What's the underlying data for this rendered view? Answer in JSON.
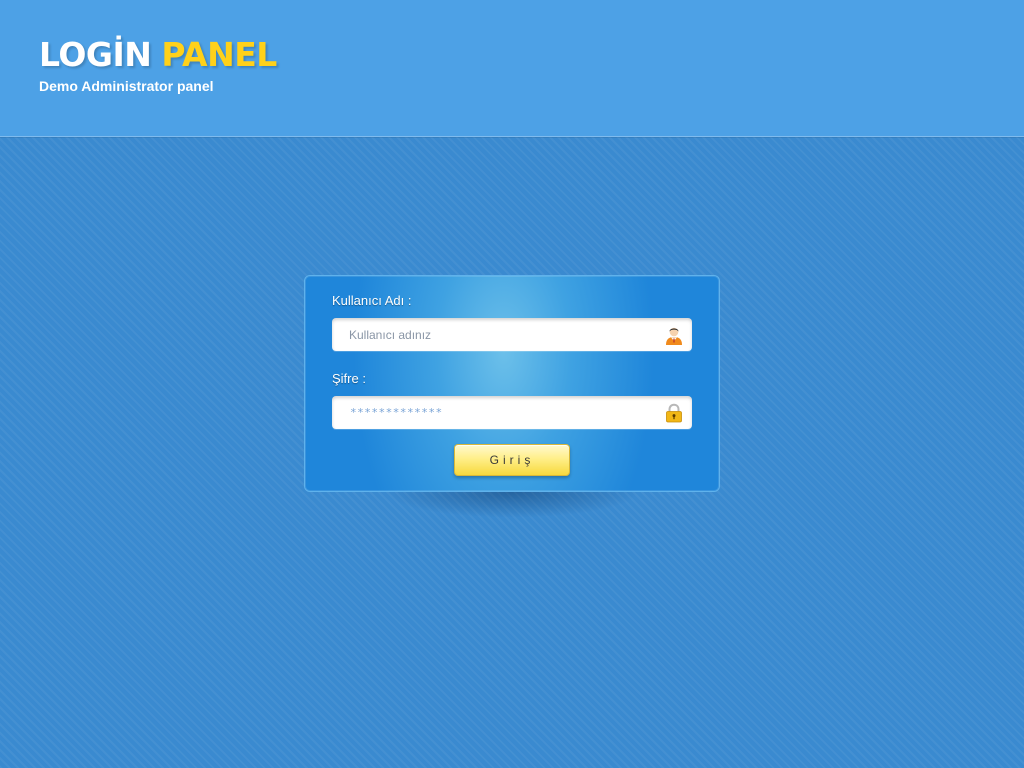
{
  "header": {
    "logo_word1": "LOGİN",
    "logo_word2": "PANEL",
    "subtitle": "Demo Administrator panel"
  },
  "form": {
    "username_label": "Kullanıcı Adı :",
    "username_placeholder": "Kullanıcı adınız",
    "username_value": "",
    "password_label": "Şifre :",
    "password_masked_value": "*************",
    "submit_label": "Giriş"
  },
  "icons": {
    "username": "user-icon",
    "password": "lock-icon"
  },
  "colors": {
    "header_bg": "#4da1e6",
    "page_bg": "#3a8ad0",
    "logo_accent": "#ffd11a",
    "button_yellow": "#f7d93e"
  }
}
